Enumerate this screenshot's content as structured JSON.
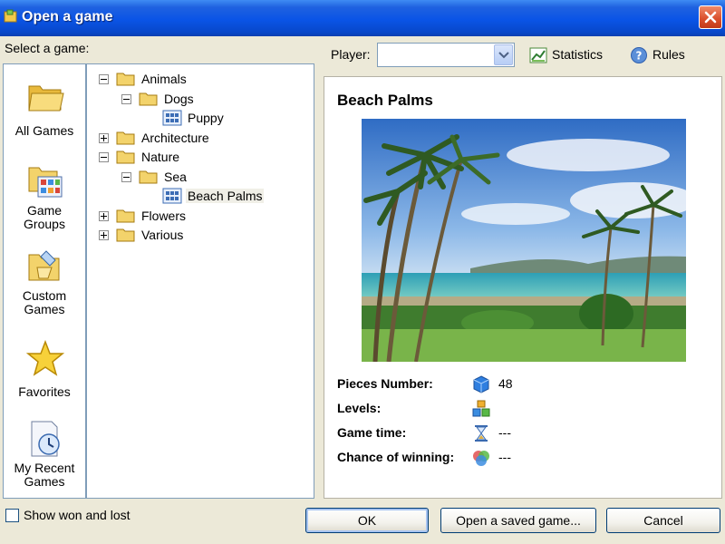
{
  "window": {
    "title": "Open a game"
  },
  "header": {
    "select_label": "Select a game:",
    "player_label": "Player:",
    "player_value": "",
    "statistics_label": "Statistics",
    "rules_label": "Rules"
  },
  "sidebar": {
    "items": [
      {
        "label": "All Games",
        "icon": "folder-icon"
      },
      {
        "label": "Game Groups",
        "icon": "game-groups-icon"
      },
      {
        "label": "Custom Games",
        "icon": "custom-games-icon"
      },
      {
        "label": "Favorites",
        "icon": "star-icon"
      },
      {
        "label": "My Recent Games",
        "icon": "recent-games-icon"
      }
    ]
  },
  "tree": {
    "nodes": [
      {
        "label": "Animals",
        "state": "expanded"
      },
      {
        "label": "Dogs",
        "state": "expanded"
      },
      {
        "label": "Puppy",
        "state": "leaf"
      },
      {
        "label": "Architecture",
        "state": "collapsed"
      },
      {
        "label": "Nature",
        "state": "expanded"
      },
      {
        "label": "Sea",
        "state": "expanded"
      },
      {
        "label": "Beach Palms",
        "state": "leaf-selected"
      },
      {
        "label": "Flowers",
        "state": "collapsed"
      },
      {
        "label": "Various",
        "state": "collapsed"
      }
    ]
  },
  "detail": {
    "title": "Beach Palms",
    "rows": [
      {
        "label": "Pieces Number:",
        "value": "48",
        "icon": "cube-icon"
      },
      {
        "label": "Levels:",
        "value": "",
        "icon": "blocks-icon"
      },
      {
        "label": "Game time:",
        "value": "---",
        "icon": "hourglass-icon"
      },
      {
        "label": "Chance of winning:",
        "value": "---",
        "icon": "chance-icon"
      }
    ]
  },
  "footer": {
    "show_label": "Show won and lost",
    "show_checked": false,
    "ok_label": "OK",
    "open_saved_label": "Open a saved game...",
    "cancel_label": "Cancel"
  },
  "colors": {
    "titlebar": "#0a54e6",
    "dialog_bg": "#ece9d8",
    "folder": "#f3d36b",
    "sea": "#36b0bb",
    "sky": "#3f7fd0"
  }
}
